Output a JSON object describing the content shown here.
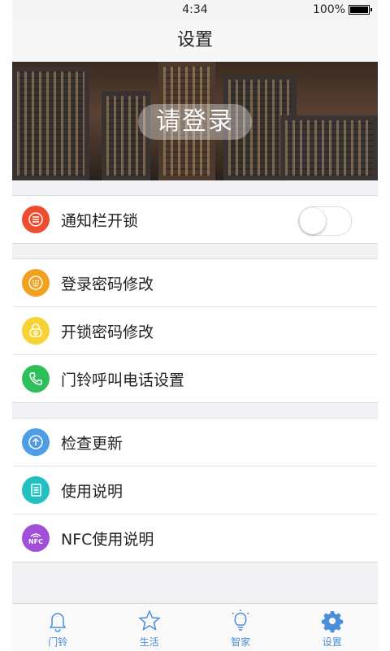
{
  "status_bar": {
    "time": "4:34",
    "battery": "100%"
  },
  "header": {
    "title": "设置"
  },
  "banner": {
    "login_label": "请登录"
  },
  "settings": {
    "notification_unlock": {
      "label": "通知栏开锁",
      "icon": "list-icon",
      "icon_color": "#ef4b2e",
      "toggle_on": false
    },
    "security_items": [
      {
        "label": "登录密码修改",
        "icon": "keypad-icon",
        "icon_color": "#f2a11d"
      },
      {
        "label": "开锁密码修改",
        "icon": "lock-icon",
        "icon_color": "#f6d235"
      },
      {
        "label": "门铃呼叫电话设置",
        "icon": "phone-icon",
        "icon_color": "#2fbf5a"
      }
    ],
    "info_items": [
      {
        "label": "检查更新",
        "icon": "upload-arrow-icon",
        "icon_color": "#4f9de6"
      },
      {
        "label": "使用说明",
        "icon": "document-icon",
        "icon_color": "#22c1bf"
      },
      {
        "label": "NFC使用说明",
        "icon": "nfc-icon",
        "icon_color": "#a14ed8",
        "icon_text": "NFC"
      }
    ]
  },
  "tabbar": {
    "tabs": [
      {
        "label": "门铃",
        "icon": "bell-icon"
      },
      {
        "label": "生活",
        "icon": "star-icon"
      },
      {
        "label": "智家",
        "icon": "lightbulb-icon"
      },
      {
        "label": "设置",
        "icon": "gear-icon",
        "active": true
      }
    ],
    "accent_color": "#4a8fd8"
  }
}
